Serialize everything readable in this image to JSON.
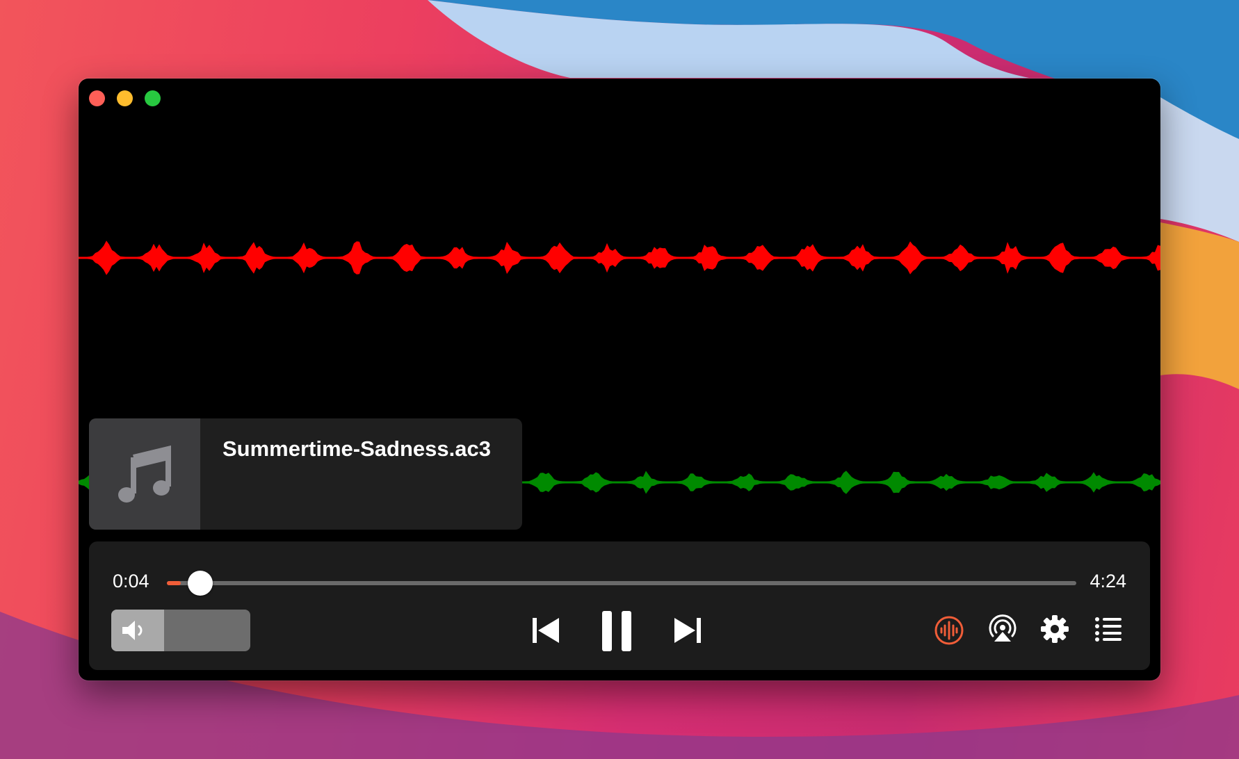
{
  "window": {
    "buttons": [
      "close",
      "minimize",
      "zoom"
    ]
  },
  "visualizer": {
    "upper_channel_color": "#ff0000",
    "lower_channel_color": "#008a00"
  },
  "now_playing": {
    "title": "Summertime-Sadness.ac3",
    "artwork_icon": "music-note-icon"
  },
  "playback": {
    "elapsed": "0:04",
    "duration": "4:24",
    "progress": 0.015,
    "accent_color": "#f05d38"
  },
  "volume": {
    "level": 0.38,
    "icon": "speaker-icon"
  },
  "transport": {
    "previous_icon": "skip-back-icon",
    "play_pause_icon": "pause-icon",
    "next_icon": "skip-forward-icon"
  },
  "toolbar": {
    "icons": [
      "audio-waveform-icon",
      "airplay-icon",
      "gear-icon",
      "playlist-icon"
    ]
  }
}
